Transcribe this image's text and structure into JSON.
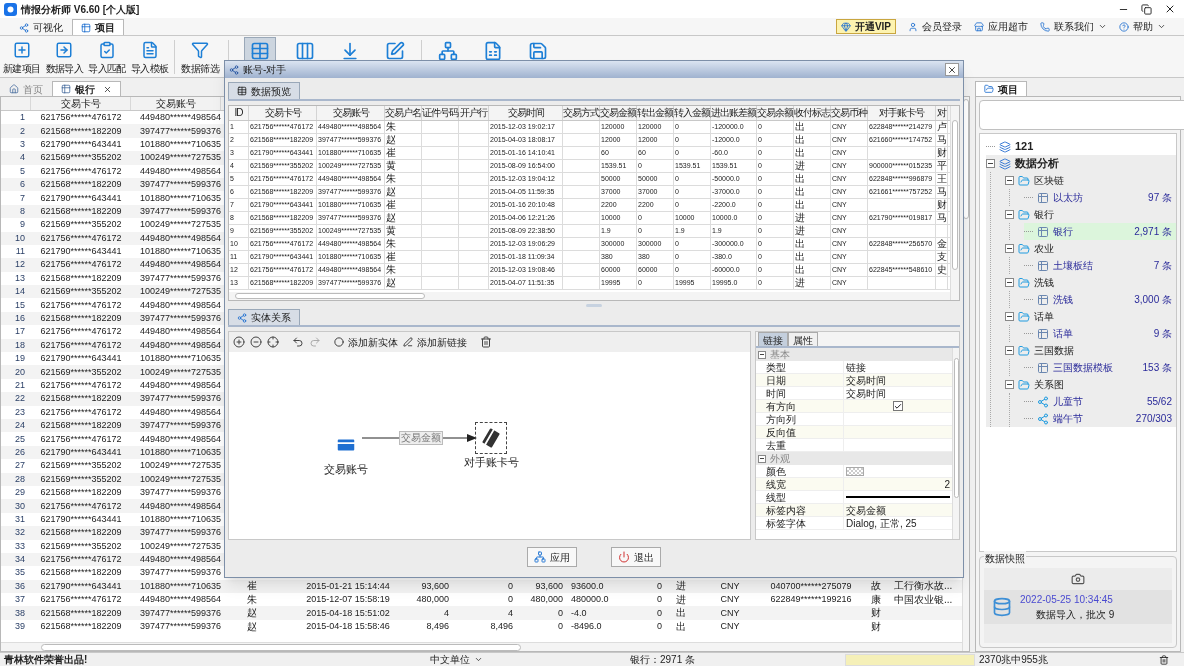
{
  "window": {
    "title": "情报分析师 V6.60 [个人版]"
  },
  "main_tabs": [
    {
      "label": "可视化",
      "selected": false
    },
    {
      "label": "项目",
      "selected": true
    }
  ],
  "header_links": [
    {
      "label": "开通VIP",
      "kind": "vip"
    },
    {
      "label": "会员登录",
      "kind": "user"
    },
    {
      "label": "应用超市",
      "kind": "store"
    },
    {
      "label": "联系我们",
      "kind": "phone",
      "dropdown": true
    },
    {
      "label": "帮助",
      "kind": "help",
      "dropdown": true
    }
  ],
  "toolbar": [
    {
      "label": "新建项目",
      "pressed": false
    },
    {
      "label": "数据导入",
      "pressed": false
    },
    {
      "label": "导入匹配",
      "pressed": false
    },
    {
      "label": "导入模板",
      "pressed": false
    },
    {
      "label": "数据筛选",
      "pressed": false
    },
    {
      "pressed": true
    },
    {
      "pressed": false
    },
    {
      "pressed": false
    },
    {
      "pressed": false
    },
    {
      "pressed": false
    },
    {
      "pressed": false
    },
    {
      "pressed": false
    }
  ],
  "doc_tabs": [
    {
      "label": "首页",
      "selected": false,
      "closable": false
    },
    {
      "label": "银行",
      "selected": true,
      "closable": true
    }
  ],
  "table": {
    "columns": [
      "交易卡号",
      "交易账号"
    ],
    "rows": [
      {
        "n": "1",
        "card": "621756******476172",
        "account": "449480******498564"
      },
      {
        "n": "2",
        "card": "621568******182209",
        "account": "397477******599376"
      },
      {
        "n": "3",
        "card": "621790******643441",
        "account": "101880******710635"
      },
      {
        "n": "4",
        "card": "621569******355202",
        "account": "100249******727535"
      },
      {
        "n": "5",
        "card": "621756******476172",
        "account": "449480******498564"
      },
      {
        "n": "6",
        "card": "621568******182209",
        "account": "397477******599376"
      },
      {
        "n": "7",
        "card": "621790******643441",
        "account": "101880******710635"
      },
      {
        "n": "8",
        "card": "621568******182209",
        "account": "397477******599376"
      },
      {
        "n": "9",
        "card": "621569******355202",
        "account": "100249******727535"
      },
      {
        "n": "10",
        "card": "621756******476172",
        "account": "449480******498564"
      },
      {
        "n": "11",
        "card": "621790******643441",
        "account": "101880******710635"
      },
      {
        "n": "12",
        "card": "621756******476172",
        "account": "449480******498564"
      },
      {
        "n": "13",
        "card": "621568******182209",
        "account": "397477******599376"
      },
      {
        "n": "14",
        "card": "621569******355202",
        "account": "100249******727535"
      },
      {
        "n": "15",
        "card": "621756******476172",
        "account": "449480******498564"
      },
      {
        "n": "16",
        "card": "621568******182209",
        "account": "397477******599376"
      },
      {
        "n": "17",
        "card": "621756******476172",
        "account": "449480******498564"
      },
      {
        "n": "18",
        "card": "621756******476172",
        "account": "449480******498564"
      },
      {
        "n": "19",
        "card": "621790******643441",
        "account": "101880******710635"
      },
      {
        "n": "20",
        "card": "621569******355202",
        "account": "100249******727535"
      },
      {
        "n": "21",
        "card": "621756******476172",
        "account": "449480******498564"
      },
      {
        "n": "22",
        "card": "621568******182209",
        "account": "397477******599376"
      },
      {
        "n": "23",
        "card": "621756******476172",
        "account": "449480******498564"
      },
      {
        "n": "24",
        "card": "621568******182209",
        "account": "397477******599376"
      },
      {
        "n": "25",
        "card": "621756******476172",
        "account": "449480******498564"
      },
      {
        "n": "26",
        "card": "621790******643441",
        "account": "101880******710635"
      },
      {
        "n": "27",
        "card": "621569******355202",
        "account": "100249******727535"
      },
      {
        "n": "28",
        "card": "621569******355202",
        "account": "100249******727535"
      },
      {
        "n": "29",
        "card": "621568******182209",
        "account": "397477******599376"
      },
      {
        "n": "30",
        "card": "621756******476172",
        "account": "449480******498564"
      },
      {
        "n": "31",
        "card": "621790******643441",
        "account": "101880******710635"
      },
      {
        "n": "32",
        "card": "621568******182209",
        "account": "397477******599376"
      },
      {
        "n": "33",
        "card": "621569******355202",
        "account": "100249******727535"
      },
      {
        "n": "34",
        "card": "621756******476172",
        "account": "449480******498564"
      },
      {
        "n": "35",
        "card": "621568******182209",
        "account": "397477******599376"
      },
      {
        "n": "36",
        "card": "621790******643441",
        "account": "101880******710635",
        "name": "崔",
        "time": "2015-01-21 15:14:44",
        "amount": "93,600",
        "out": "0",
        "in": "93,600",
        "diff": "93600.0",
        "balance": "0",
        "flag": "进",
        "currency": "CNY",
        "cp_card": "040700******275079",
        "cp_name": "故",
        "bank": "工行衡水故..."
      },
      {
        "n": "37",
        "card": "621756******476172",
        "account": "449480******498564",
        "name": "朱",
        "time": "2015-12-07 15:58:19",
        "amount": "480,000",
        "out": "0",
        "in": "480,000",
        "diff": "480000.0",
        "balance": "0",
        "flag": "进",
        "currency": "CNY",
        "cp_card": "622849******199216",
        "cp_name": "康",
        "bank": "中国农业银..."
      },
      {
        "n": "38",
        "card": "621568******182209",
        "account": "397477******599376",
        "name": "赵",
        "time": "2015-04-18 15:51:02",
        "amount": "4",
        "out": "4",
        "in": "0",
        "diff": "-4.0",
        "balance": "0",
        "flag": "出",
        "currency": "CNY",
        "cp_name": "财"
      },
      {
        "n": "39",
        "card": "621568******182209",
        "account": "397477******599376",
        "name": "赵",
        "time": "2015-04-18 15:58:46",
        "amount": "8,496",
        "out": "8,496",
        "in": "0",
        "diff": "-8496.0",
        "balance": "0",
        "flag": "出",
        "currency": "CNY",
        "cp_name": "财"
      }
    ]
  },
  "dialog": {
    "title": "账号-对手",
    "preview_tab": "数据预览",
    "columns": [
      "ID",
      "交易卡号",
      "交易账号",
      "交易户名",
      "证件号码",
      "开户行",
      "交易时间",
      "交易方式",
      "交易金额",
      "转出金额",
      "转入金额",
      "进出账差额",
      "交易余额",
      "收付标志",
      "交易币种",
      "对手账卡号",
      "对"
    ],
    "rows": [
      [
        "1",
        "621756******476172",
        "449480******498564",
        "朱",
        null,
        null,
        "2015-12-03 19:02:17",
        null,
        "120000",
        "120000",
        "0",
        "-120000.0",
        "0",
        "出",
        "CNY",
        "622848******214279",
        "卢"
      ],
      [
        "2",
        "621568******182209",
        "397477******599376",
        "赵",
        null,
        null,
        "2015-04-03 18:08:17",
        null,
        "12000",
        "12000",
        "0",
        "-12000.0",
        "0",
        "出",
        "CNY",
        "621660******174752",
        "马"
      ],
      [
        "3",
        "621790******643441",
        "101880******710635",
        "崔",
        null,
        null,
        "2015-01-16 14:10:41",
        null,
        "60",
        "60",
        "0",
        "-60.0",
        "0",
        "出",
        "CNY",
        null,
        "财"
      ],
      [
        "4",
        "621569******355202",
        "100249******727535",
        "黄",
        null,
        null,
        "2015-08-09 16:54:00",
        null,
        "1539.51",
        "0",
        "1539.51",
        "1539.51",
        "0",
        "进",
        "CNY",
        "900000******015235",
        "平"
      ],
      [
        "5",
        "621756******476172",
        "449480******498564",
        "朱",
        null,
        null,
        "2015-12-03 19:04:12",
        null,
        "50000",
        "50000",
        "0",
        "-50000.0",
        "0",
        "出",
        "CNY",
        "622848******996879",
        "王"
      ],
      [
        "6",
        "621568******182209",
        "397477******599376",
        "赵",
        null,
        null,
        "2015-04-05 11:59:35",
        null,
        "37000",
        "37000",
        "0",
        "-37000.0",
        "0",
        "出",
        "CNY",
        "621661******757252",
        "马"
      ],
      [
        "7",
        "621790******643441",
        "101880******710635",
        "崔",
        null,
        null,
        "2015-01-16 20:10:48",
        null,
        "2200",
        "2200",
        "0",
        "-2200.0",
        "0",
        "出",
        "CNY",
        null,
        "财"
      ],
      [
        "8",
        "621568******182209",
        "397477******599376",
        "赵",
        null,
        null,
        "2015-04-06 12:21:26",
        null,
        "10000",
        "0",
        "10000",
        "10000.0",
        "0",
        "进",
        "CNY",
        "621790******019817",
        "马"
      ],
      [
        "9",
        "621569******355202",
        "100249******727535",
        "黄",
        null,
        null,
        "2015-08-09 22:38:50",
        null,
        "1.9",
        "0",
        "1.9",
        "1.9",
        "0",
        "进",
        "CNY",
        null,
        null
      ],
      [
        "10",
        "621756******476172",
        "449480******498564",
        "朱",
        null,
        null,
        "2015-12-03 19:06:29",
        null,
        "300000",
        "300000",
        "0",
        "-300000.0",
        "0",
        "出",
        "CNY",
        "622848******256570",
        "金"
      ],
      [
        "11",
        "621790******643441",
        "101880******710635",
        "崔",
        null,
        null,
        "2015-01-18 11:09:34",
        null,
        "380",
        "380",
        "0",
        "-380.0",
        "0",
        "出",
        "CNY",
        null,
        "支"
      ],
      [
        "12",
        "621756******476172",
        "449480******498564",
        "朱",
        null,
        null,
        "2015-12-03 19:08:46",
        null,
        "60000",
        "60000",
        "0",
        "-60000.0",
        "0",
        "出",
        "CNY",
        "622845******548610",
        "史"
      ],
      [
        "13",
        "621568******182209",
        "397477******599376",
        "赵",
        null,
        null,
        "2015-04-07 11:51:35",
        null,
        "19995",
        "0",
        "19995",
        "19995.0",
        "0",
        "进",
        "CNY",
        null,
        null
      ]
    ],
    "graph_tab": "实体关系",
    "graph": {
      "toolbar": [
        {
          "kind": "zoom-in"
        },
        {
          "kind": "zoom-out"
        },
        {
          "kind": "fit"
        },
        {
          "kind": "undo"
        },
        {
          "kind": "redo"
        },
        {
          "kind": "add-entity",
          "label": "添加新实体"
        },
        {
          "kind": "add-link",
          "label": "添加新链接"
        },
        {
          "kind": "delete"
        }
      ],
      "nodes": [
        {
          "label": "交易账号",
          "kind": "card",
          "selected": false
        },
        {
          "label": "对手账卡号",
          "kind": "dark-card",
          "selected": true
        }
      ],
      "edge": {
        "label": "交易金额"
      }
    },
    "properties": {
      "tabs": [
        {
          "label": "链接",
          "selected": true
        },
        {
          "label": "属性",
          "selected": false
        }
      ],
      "groups": [
        {
          "title": "基本",
          "expanded": true,
          "items": [
            {
              "label": "类型",
              "kind": "text",
              "value": "链接"
            },
            {
              "label": "日期",
              "kind": "text",
              "value": "交易时间"
            },
            {
              "label": "时间",
              "kind": "text",
              "value": "交易时间"
            },
            {
              "label": "有方向",
              "kind": "check",
              "checked": true
            },
            {
              "label": "方向列",
              "kind": "text"
            },
            {
              "label": "反向值",
              "kind": "text"
            },
            {
              "label": "去重",
              "kind": "text"
            }
          ]
        },
        {
          "title": "外观",
          "expanded": true,
          "items": [
            {
              "label": "颜色",
              "kind": "color"
            },
            {
              "label": "线宽",
              "kind": "number",
              "value": "2"
            },
            {
              "label": "线型",
              "kind": "line"
            },
            {
              "label": "标签内容",
              "kind": "text",
              "value": "交易金额"
            },
            {
              "label": "标签字体",
              "kind": "text",
              "value": "Dialog, 正常, 25"
            }
          ]
        }
      ]
    },
    "buttons": [
      {
        "label": "应用",
        "kind": "apply"
      },
      {
        "label": "退出",
        "kind": "exit"
      }
    ]
  },
  "project_panel": {
    "tab": "项目",
    "tree": [
      {
        "label": "121",
        "kind": "project"
      },
      {
        "label": "数据分析",
        "kind": "project",
        "expanded": true,
        "children": [
          {
            "label": "区块链",
            "kind": "folder",
            "expanded": true,
            "children": [
              {
                "label": "以太坊",
                "kind": "table",
                "count": "97 条",
                "selected": false
              }
            ]
          },
          {
            "label": "银行",
            "kind": "folder",
            "expanded": true,
            "children": [
              {
                "label": "银行",
                "kind": "table",
                "count": "2,971 条",
                "selected": true
              }
            ]
          },
          {
            "label": "农业",
            "kind": "folder",
            "expanded": true,
            "children": [
              {
                "label": "土壤板结",
                "kind": "table",
                "count": "7 条",
                "selected": false
              }
            ]
          },
          {
            "label": "洗钱",
            "kind": "folder",
            "expanded": true,
            "children": [
              {
                "label": "洗钱",
                "kind": "table",
                "count": "3,000 条",
                "selected": false
              }
            ]
          },
          {
            "label": "话单",
            "kind": "folder",
            "expanded": true,
            "children": [
              {
                "label": "话单",
                "kind": "table",
                "count": "9 条",
                "selected": false
              }
            ]
          },
          {
            "label": "三国数据",
            "kind": "folder",
            "expanded": true,
            "children": [
              {
                "label": "三国数据模板",
                "kind": "table",
                "count": "153 条",
                "selected": false
              }
            ]
          },
          {
            "label": "关系图",
            "kind": "folder",
            "expanded": true,
            "children": [
              {
                "label": "儿童节",
                "kind": "graph",
                "count": "55/62",
                "selected": false
              },
              {
                "label": "端午节",
                "kind": "graph",
                "count": "270/303",
                "selected": false
              }
            ]
          }
        ]
      }
    ],
    "snapshot": {
      "title": "数据快照",
      "time": "2022-05-25 10:34:45",
      "text": "数据导入，批次 9"
    }
  },
  "status_bar": {
    "credit": "青林软件荣誉出品!",
    "unit": "中文单位",
    "count": "银行：2971 条",
    "memory": "2370兆中955兆"
  }
}
